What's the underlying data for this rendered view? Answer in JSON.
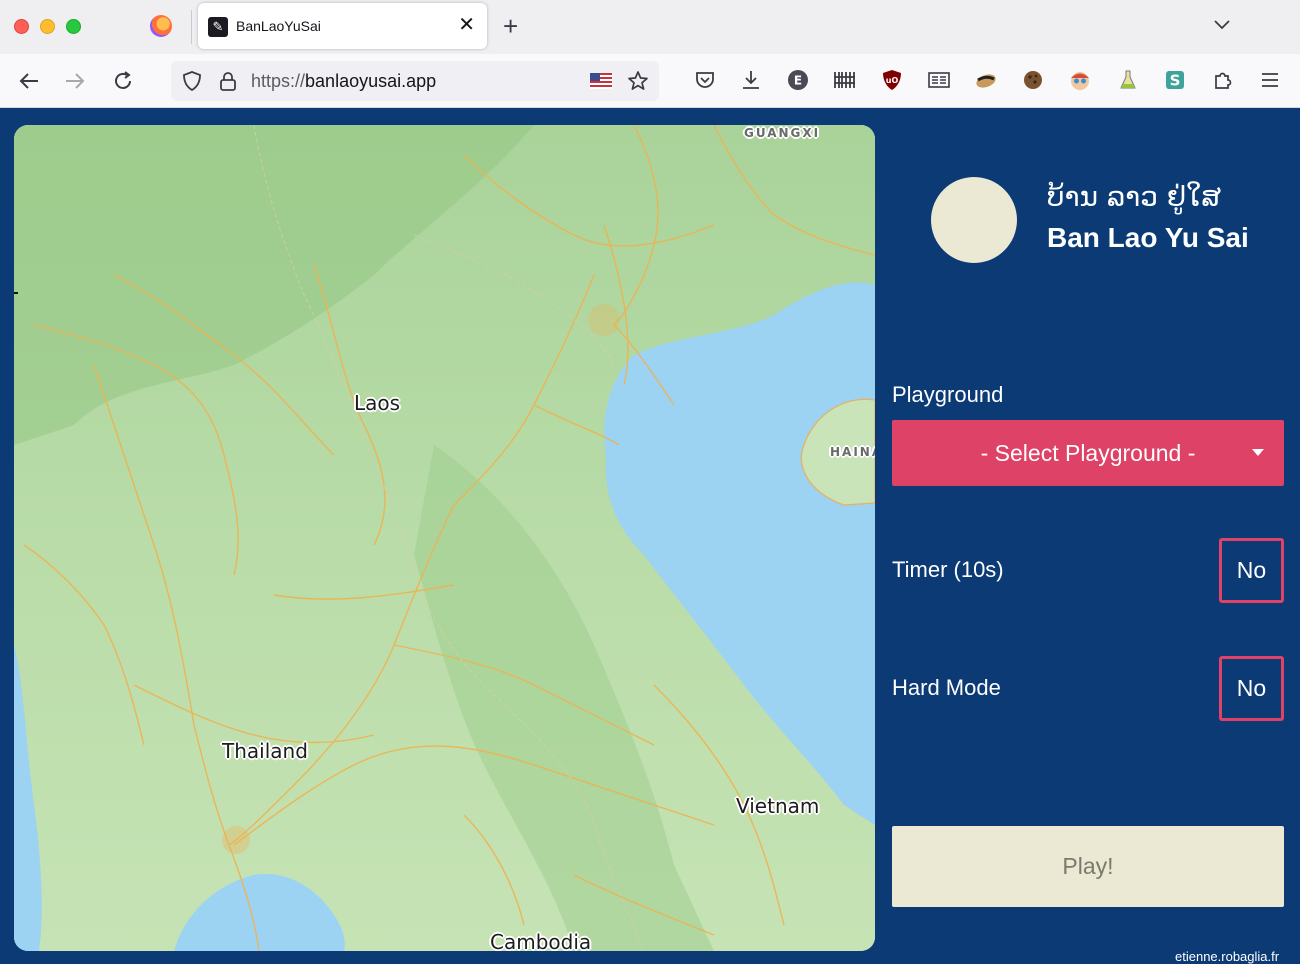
{
  "browser": {
    "tab_title": "BanLaoYuSai",
    "url_scheme": "https://",
    "url_host": "banlaoyusai.app",
    "extensions": [
      "pocket-icon",
      "download-icon",
      "e-icon",
      "barcode-icon",
      "ublock-icon",
      "reader-icon",
      "raccoon-icon",
      "cookie-icon",
      "face-icon",
      "flask-icon",
      "s-icon",
      "puzzle-icon",
      "menu-icon"
    ]
  },
  "header": {
    "title_lao": "ບ້ານ ລາວ ຢູ່ໃສ",
    "title_en": "Ban Lao Yu Sai"
  },
  "map": {
    "labels": {
      "laos": "Laos",
      "thailand": "Thailand",
      "vietnam": "Vietnam",
      "cambodia": "Cambodia",
      "guangxi": "GUANGXI",
      "hainan": "HAINA"
    }
  },
  "form": {
    "playground_label": "Playground",
    "playground_select": "- Select Playground -",
    "timer_label": "Timer (10s)",
    "timer_value": "No",
    "hard_mode_label": "Hard Mode",
    "hard_mode_value": "No",
    "play_button": "Play!"
  },
  "footer": {
    "credit": "etienne.robaglia.fr"
  },
  "colors": {
    "background": "#0b3a75",
    "accent": "#de4266",
    "cream": "#ebe8d3"
  }
}
